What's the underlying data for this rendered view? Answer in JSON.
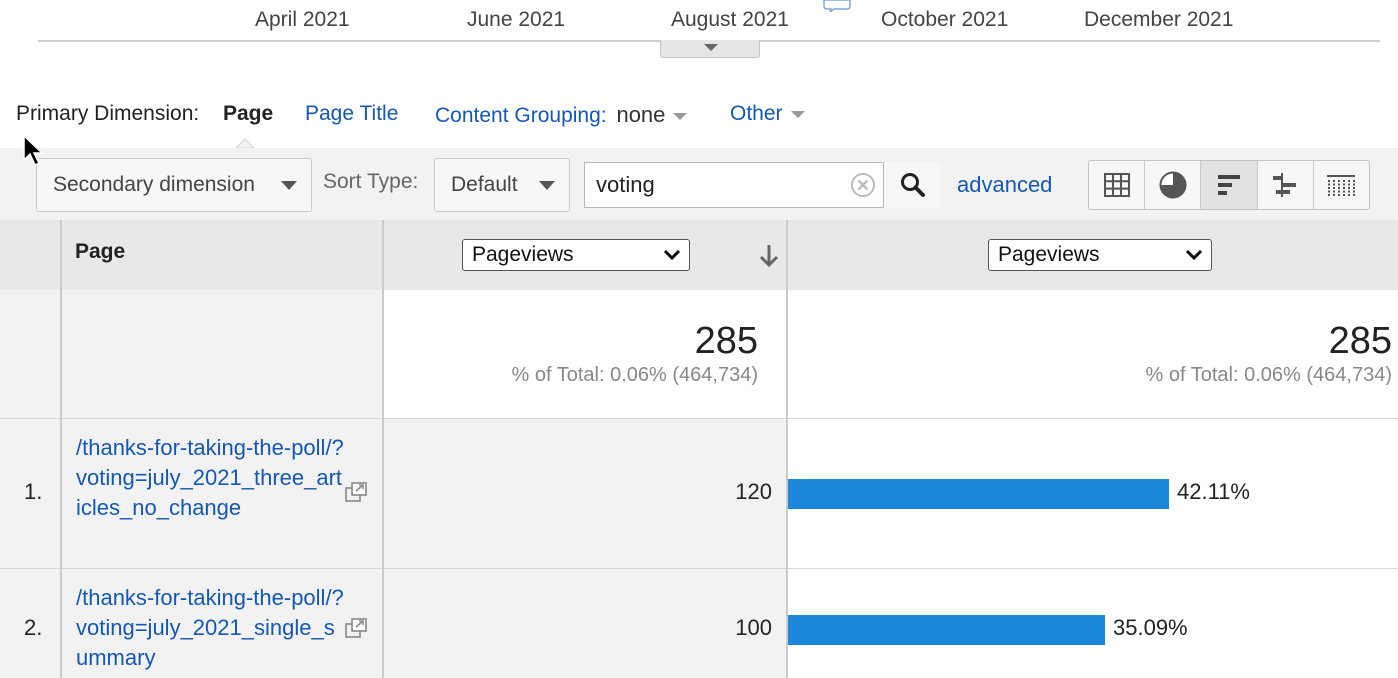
{
  "timeline": {
    "labels": [
      "April 2021",
      "June 2021",
      "August 2021",
      "October 2021",
      "December 2021"
    ]
  },
  "primary_dimension": {
    "label": "Primary Dimension:",
    "active": "Page",
    "page_title": "Page Title",
    "content_grouping_label": "Content Grouping:",
    "content_grouping_value": "none",
    "other": "Other"
  },
  "toolbar": {
    "secondary_dimension": "Secondary dimension",
    "sort_type_label": "Sort Type:",
    "sort_type_value": "Default",
    "search_value": "voting",
    "advanced": "advanced"
  },
  "table": {
    "page_header": "Page",
    "metric1": "Pageviews",
    "metric2": "Pageviews",
    "totals": {
      "value1": "285",
      "sub1": "% of Total: 0.06% (464,734)",
      "value2": "285",
      "sub2": "% of Total: 0.06% (464,734)"
    },
    "rows": [
      {
        "num": "1.",
        "page": "/thanks-for-taking-the-poll/?voting=july_2021_three_articles_no_change",
        "value": "120",
        "percent": "42.11%",
        "share": 0.4211
      },
      {
        "num": "2.",
        "page": "/thanks-for-taking-the-poll/?voting=july_2021_single_summary",
        "value": "100",
        "percent": "35.09%",
        "share": 0.3509
      }
    ]
  },
  "colors": {
    "link": "#1558b3",
    "bar": "#1a87d9"
  },
  "icons": {
    "grid_view": "grid-icon",
    "pie_view": "pie-chart-icon",
    "performance_view": "bar-chart-icon",
    "comparison_view": "comparison-icon",
    "pivot_view": "pivot-icon"
  }
}
